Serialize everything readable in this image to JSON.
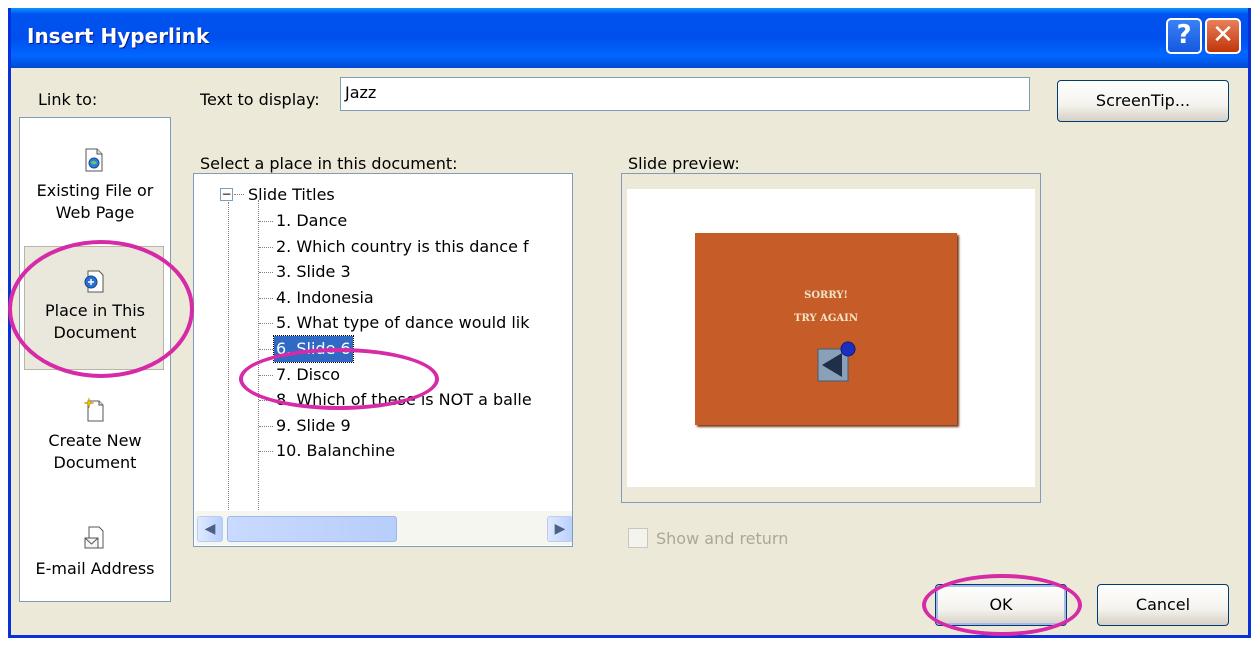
{
  "window": {
    "title": "Insert Hyperlink",
    "help_glyph": "?",
    "close_glyph": "✕"
  },
  "link_to": {
    "label": "Link to:",
    "items": [
      {
        "line1": "Existing File or",
        "line2": "Web Page",
        "icon": "web-page-icon"
      },
      {
        "line1": "Place in This",
        "line2": "Document",
        "icon": "place-in-document-icon",
        "selected": true
      },
      {
        "line1": "Create New",
        "line2": "Document",
        "icon": "new-document-icon"
      },
      {
        "line1": "E-mail Address",
        "line2": "",
        "icon": "email-icon"
      }
    ]
  },
  "text_to_display": {
    "label": "Text to display:",
    "value": "Jazz"
  },
  "screentip_button": "ScreenTip...",
  "place_list": {
    "label": "Select a place in this document:",
    "root": "Slide Titles",
    "root_toggle": "−",
    "items": [
      "1. Dance",
      "2. Which country is this dance f",
      "3. Slide 3",
      "4. Indonesia",
      "5. What type of dance would lik",
      "6. Slide 6",
      "7. Disco",
      "8. Which of these is NOT a balle",
      "9. Slide 9",
      "10. Balanchine"
    ],
    "selected_index": 5
  },
  "preview": {
    "label": "Slide preview:",
    "slide_line1": "SORRY!",
    "slide_line2": "TRY AGAIN",
    "slide_color": "#c65d28"
  },
  "show_and_return": {
    "label": "Show and return",
    "checked": false,
    "enabled": false
  },
  "buttons": {
    "ok": "OK",
    "cancel": "Cancel"
  },
  "colors": {
    "title_bar": "#0054e3",
    "dialog_bg": "#ece9d8",
    "selection": "#316ac5",
    "highlight_circle": "#d62aa6"
  }
}
